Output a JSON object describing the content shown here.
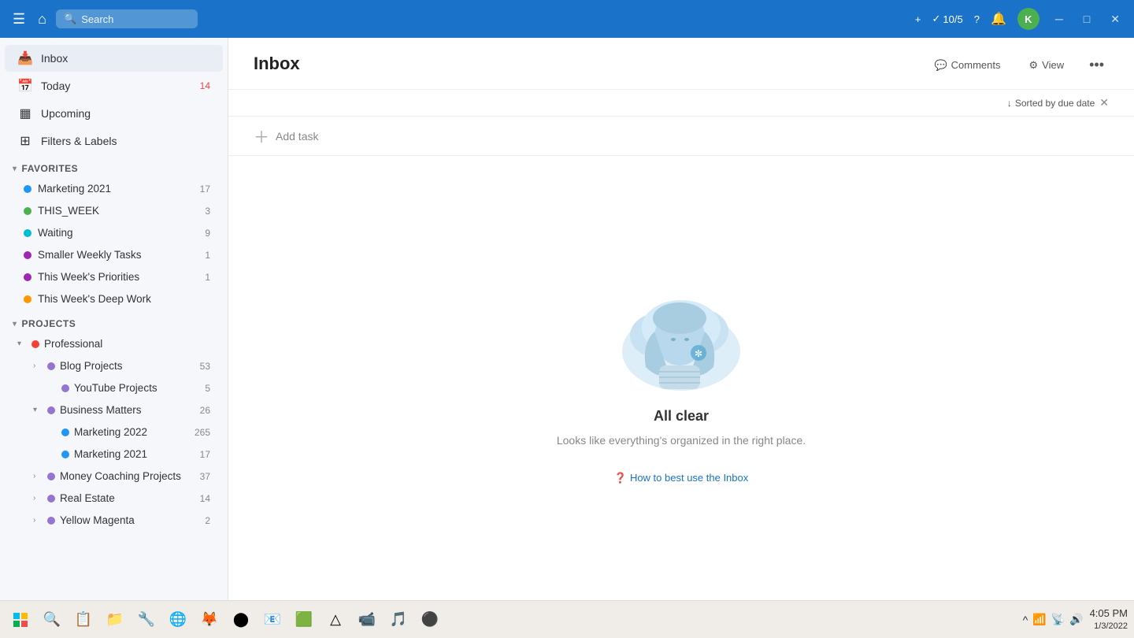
{
  "titlebar": {
    "search_placeholder": "Search",
    "karma": "10/5",
    "avatar_initial": "K",
    "add_label": "+",
    "help_label": "?",
    "bell_label": "🔔"
  },
  "sidebar": {
    "nav_items": [
      {
        "id": "inbox",
        "icon": "📥",
        "label": "Inbox",
        "count": null,
        "active": true
      },
      {
        "id": "today",
        "icon": "📅",
        "label": "Today",
        "count": "14",
        "active": false
      },
      {
        "id": "upcoming",
        "icon": "▦",
        "label": "Upcoming",
        "count": null,
        "active": false
      },
      {
        "id": "filters",
        "icon": "⊞",
        "label": "Filters & Labels",
        "count": null,
        "active": false
      }
    ],
    "favorites_label": "Favorites",
    "favorites": [
      {
        "id": "marketing2021",
        "label": "Marketing 2021",
        "color": "#2196f3",
        "count": "17"
      },
      {
        "id": "this_week",
        "label": "THIS_WEEK",
        "color": "#4caf50",
        "count": "3"
      },
      {
        "id": "waiting",
        "label": "Waiting",
        "color": "#00bcd4",
        "count": "9"
      },
      {
        "id": "smaller_weekly",
        "label": "Smaller Weekly Tasks",
        "color": "#9c27b0",
        "count": "1"
      },
      {
        "id": "this_week_priorities",
        "label": "This Week's Priorities",
        "color": "#9c27b0",
        "count": "1"
      },
      {
        "id": "this_week_deep",
        "label": "This Week's Deep Work",
        "color": "#ff9800",
        "count": null
      }
    ],
    "projects_label": "Projects",
    "projects": [
      {
        "id": "professional",
        "label": "Professional",
        "color": "#f44336",
        "indent": 0,
        "has_chevron": true,
        "chevron_open": true,
        "count": null
      },
      {
        "id": "blog_projects",
        "label": "Blog Projects",
        "color": "#9575cd",
        "indent": 1,
        "has_chevron": true,
        "chevron_open": false,
        "count": "53"
      },
      {
        "id": "youtube_projects",
        "label": "YouTube Projects",
        "color": "#9575cd",
        "indent": 2,
        "has_chevron": false,
        "chevron_open": false,
        "count": "5"
      },
      {
        "id": "business_matters",
        "label": "Business Matters",
        "color": "#9575cd",
        "indent": 1,
        "has_chevron": true,
        "chevron_open": true,
        "count": "26"
      },
      {
        "id": "marketing2022",
        "label": "Marketing 2022",
        "color": "#2196f3",
        "indent": 2,
        "has_chevron": false,
        "count": "265"
      },
      {
        "id": "marketing2021b",
        "label": "Marketing 2021",
        "color": "#2196f3",
        "indent": 2,
        "has_chevron": false,
        "count": "17"
      },
      {
        "id": "money_coaching",
        "label": "Money Coaching Projects",
        "color": "#9575cd",
        "indent": 1,
        "has_chevron": true,
        "chevron_open": false,
        "count": "37"
      },
      {
        "id": "real_estate",
        "label": "Real Estate",
        "color": "#9575cd",
        "indent": 1,
        "has_chevron": true,
        "chevron_open": false,
        "count": "14"
      },
      {
        "id": "yellow_magenta",
        "label": "Yellow Magenta",
        "color": "#9575cd",
        "indent": 1,
        "has_chevron": true,
        "chevron_open": false,
        "count": "2"
      }
    ]
  },
  "content": {
    "title": "Inbox",
    "comments_label": "Comments",
    "view_label": "View",
    "sort_label": "Sorted by due date",
    "add_task_label": "Add task",
    "empty_title": "All clear",
    "empty_subtitle": "Looks like everything's organized in the right place.",
    "help_link": "How to best use the Inbox"
  },
  "taskbar": {
    "time": "4:05 PM",
    "date": "1/3/2022"
  }
}
